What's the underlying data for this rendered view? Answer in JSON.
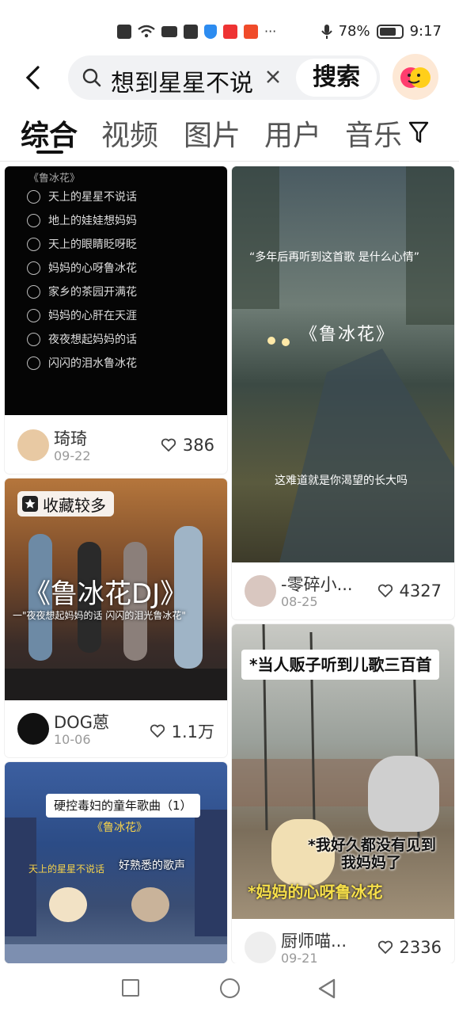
{
  "status_bar": {
    "battery": "78%",
    "time": "9:17",
    "icons": [
      "alert-icon",
      "wifi-icon",
      "video-icon",
      "message-icon",
      "shield-icon",
      "book-icon",
      "app-icon",
      "more-icon",
      "mic-icon",
      "battery-icon"
    ]
  },
  "search": {
    "query": "想到星星不说",
    "button_label": "搜索"
  },
  "tabs": [
    {
      "label": "综合",
      "active": true
    },
    {
      "label": "视频",
      "active": false
    },
    {
      "label": "图片",
      "active": false
    },
    {
      "label": "用户",
      "active": false
    },
    {
      "label": "音乐",
      "active": false
    }
  ],
  "feed": {
    "left": [
      {
        "image": {
          "title": "《鲁冰花》",
          "lines": [
            "天上的星星不说话",
            "地上的娃娃想妈妈",
            "天上的眼睛眨呀眨",
            "妈妈的心呀鲁冰花",
            "家乡的茶园开满花",
            "妈妈的心肝在天涯",
            "夜夜想起妈妈的话",
            "闪闪的泪水鲁冰花"
          ]
        },
        "author": "琦琦",
        "date": "09-22",
        "likes": "386"
      },
      {
        "image": {
          "badge": "收藏较多",
          "title": "《鲁冰花DJ》",
          "subtitle": "一\"夜夜想起妈妈的话 闪闪的泪光鲁冰花\""
        },
        "author": "DOG蒽",
        "date": "10-06",
        "likes": "1.1万"
      },
      {
        "image": {
          "caption": "硬控毒妇的童年歌曲（1）",
          "song": "《鲁冰花》",
          "left_text": "天上的星星不说话",
          "right_text": "好熟悉的歌声"
        }
      }
    ],
    "right": [
      {
        "image": {
          "quote": "“多年后再听到这首歌 是什么心情”",
          "song": "《鲁冰花》",
          "bottom": "这难道就是你渴望的长大吗"
        },
        "author": "-零碎小...",
        "date": "08-25",
        "likes": "4327"
      },
      {
        "image": {
          "caption": "*当人贩子听到儿歌三百首",
          "line1": "*我好久都没有见到",
          "line2": "我妈妈了",
          "line3": "*妈妈的心呀鲁冰花"
        },
        "author": "厨师喵...",
        "date": "09-21",
        "likes": "2336"
      }
    ]
  },
  "navbar": {
    "buttons": [
      "recent-apps",
      "home",
      "back"
    ]
  }
}
